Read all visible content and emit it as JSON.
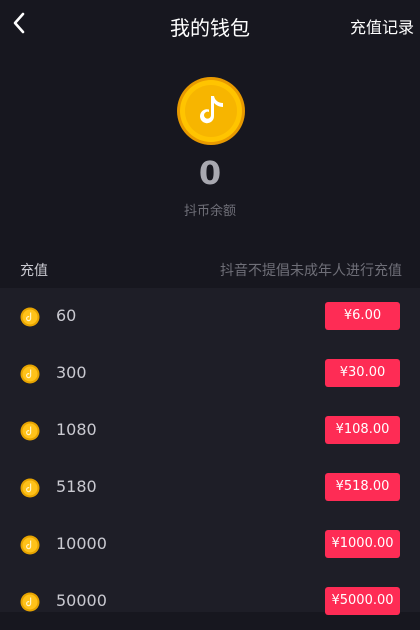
{
  "header": {
    "title": "我的钱包",
    "records_label": "充值记录"
  },
  "balance": {
    "amount": "0",
    "label": "抖币余额"
  },
  "recharge": {
    "title": "充值",
    "note": "抖音不提倡未成年人进行充值",
    "options": [
      {
        "coins": "60",
        "price": "¥6.00"
      },
      {
        "coins": "300",
        "price": "¥30.00"
      },
      {
        "coins": "1080",
        "price": "¥108.00"
      },
      {
        "coins": "5180",
        "price": "¥518.00"
      },
      {
        "coins": "10000",
        "price": "¥1000.00"
      },
      {
        "coins": "50000",
        "price": "¥5000.00"
      }
    ]
  },
  "colors": {
    "background": "#17171f",
    "list_background": "#1e1e27",
    "price_button": "#fe2c55",
    "coin_gold": "#f5b800"
  },
  "icons": {
    "back": "chevron-left-icon",
    "coin": "music-note-coin-icon"
  }
}
